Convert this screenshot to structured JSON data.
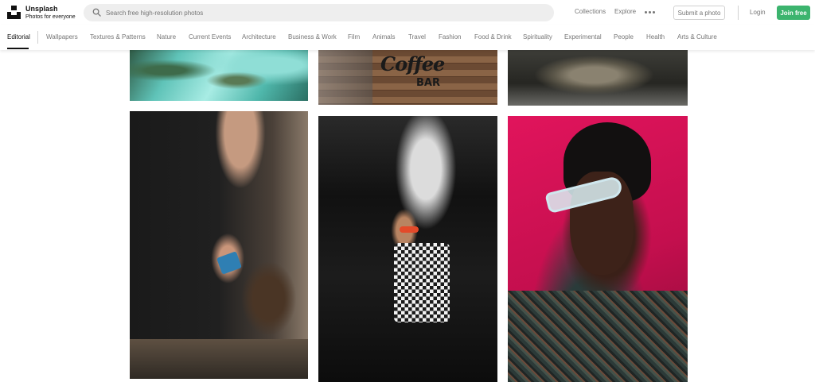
{
  "brand": {
    "name": "Unsplash",
    "tagline": "Photos for everyone"
  },
  "search": {
    "placeholder": "Search free high-resolution photos"
  },
  "header": {
    "collections": "Collections",
    "explore": "Explore",
    "submit": "Submit a photo",
    "login": "Login",
    "join": "Join free"
  },
  "categories": [
    "Editorial",
    "Wallpapers",
    "Textures & Patterns",
    "Nature",
    "Current Events",
    "Architecture",
    "Business & Work",
    "Film",
    "Animals",
    "Travel",
    "Fashion",
    "Food & Drink",
    "Spirituality",
    "Experimental",
    "People",
    "Health",
    "Arts & Culture"
  ],
  "active_category": "Editorial",
  "photos": {
    "coffee_sign_line1": "Coffee",
    "coffee_sign_line2": "BAR"
  },
  "colors": {
    "accent_green": "#3cb46e",
    "muted_text": "#767676",
    "search_bg": "#eeeeee"
  }
}
